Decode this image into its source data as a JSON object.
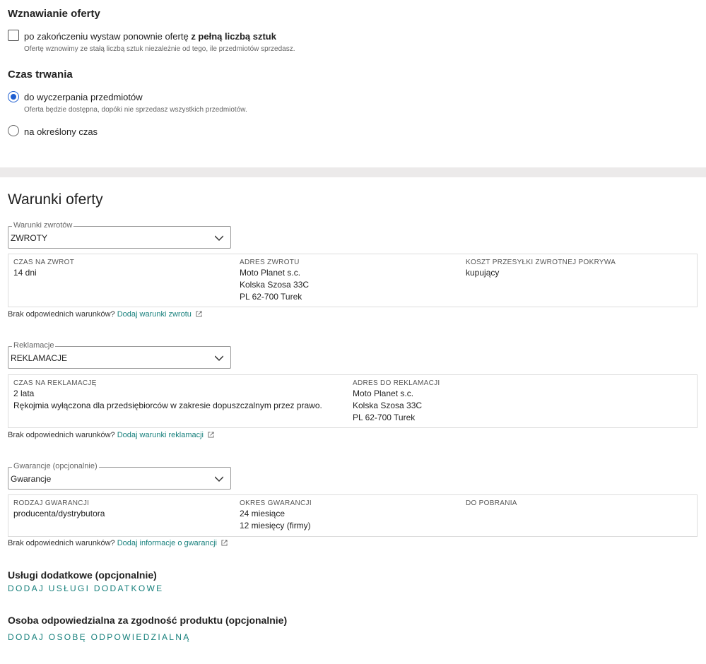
{
  "renewal": {
    "title": "Wznawianie oferty",
    "option_prefix": "po zakończeniu wystaw ponownie ofertę ",
    "option_bold": "z pełną liczbą sztuk",
    "option_checked": false,
    "option_hint": "Ofertę wznowimy ze stałą liczbą sztuk niezależnie od tego, ile przedmiotów sprzedasz."
  },
  "duration": {
    "title": "Czas trwania",
    "options": [
      {
        "label": "do wyczerpania przedmiotów",
        "hint": "Oferta będzie dostępna, dopóki nie sprzedasz wszystkich przedmiotów.",
        "selected": true
      },
      {
        "label": "na określony czas",
        "selected": false
      }
    ]
  },
  "terms": {
    "title": "Warunki oferty",
    "returns": {
      "legend": "Warunki zwrotów",
      "value": "ZWROTY",
      "cols": [
        {
          "label": "CZAS NA ZWROT",
          "lines": [
            "14 dni"
          ]
        },
        {
          "label": "ADRES ZWROTU",
          "lines": [
            "Moto Planet s.c.",
            "Kolska Szosa 33C",
            "PL 62-700 Turek"
          ]
        },
        {
          "label": "KOSZT PRZESYŁKI ZWROTNEJ POKRYWA",
          "lines": [
            "kupujący"
          ]
        }
      ],
      "note": "Brak odpowiednich warunków?",
      "link": "Dodaj warunki zwrotu"
    },
    "complaints": {
      "legend": "Reklamacje",
      "value": "REKLAMACJE",
      "cols": [
        {
          "label": "CZAS NA REKLAMACJĘ",
          "lines": [
            "2 lata",
            "Rękojmia wyłączona dla przedsiębiorców w zakresie dopuszczalnym przez prawo."
          ]
        },
        {
          "label": "ADRES DO REKLAMACJI",
          "lines": [
            "Moto Planet s.c.",
            "Kolska Szosa 33C",
            "PL 62-700 Turek"
          ]
        }
      ],
      "note": "Brak odpowiednich warunków?",
      "link": "Dodaj warunki reklamacji"
    },
    "warranty": {
      "legend": "Gwarancje (opcjonalnie)",
      "value": "Gwarancje",
      "cols": [
        {
          "label": "RODZAJ GWARANCJI",
          "lines": [
            "producenta/dystrybutora"
          ]
        },
        {
          "label": "OKRES GWARANCJI",
          "lines": [
            "24 miesiące",
            "12 miesięcy (firmy)"
          ]
        },
        {
          "label": "DO POBRANIA",
          "lines": []
        }
      ],
      "note": "Brak odpowiednich warunków?",
      "link": "Dodaj informacje o gwarancji"
    }
  },
  "extras": {
    "title": "Usługi dodatkowe (opcjonalnie)",
    "action": "DODAJ USŁUGI DODATKOWE"
  },
  "responsible": {
    "title": "Osoba odpowiedzialna za zgodność produktu (opcjonalnie)",
    "action": "DODAJ OSOBĘ ODPOWIEDZIALNĄ"
  },
  "colors": {
    "accent": "#157f7b",
    "radio": "#1f5fd1",
    "band": "#eceaea"
  }
}
